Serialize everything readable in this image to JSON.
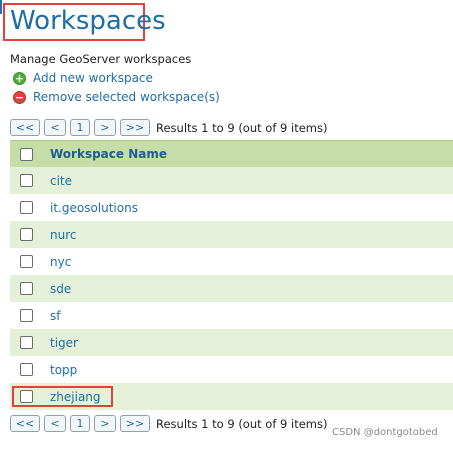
{
  "page": {
    "title": "Workspaces",
    "subtitle": "Manage GeoServer workspaces"
  },
  "actions": {
    "add_label": "Add new workspace",
    "remove_label": "Remove selected workspace(s)",
    "add_icon": "plus-circle-icon",
    "remove_icon": "minus-circle-icon"
  },
  "pager": {
    "first": "<<",
    "prev": "<",
    "page": "1",
    "next": ">",
    "last": ">>",
    "results": "Results 1 to 9 (out of 9 items)"
  },
  "table": {
    "header": "Workspace Name",
    "rows": [
      "cite",
      "it.geosolutions",
      "nurc",
      "nyc",
      "sde",
      "sf",
      "tiger",
      "topp",
      "zhejiang"
    ]
  },
  "watermark": "CSDN @dontgotobed",
  "colors": {
    "accent": "#1f6ea7",
    "header_bg": "#c5dea7",
    "row_alt_bg": "#e5f0d8",
    "highlight": "#e0413d"
  }
}
